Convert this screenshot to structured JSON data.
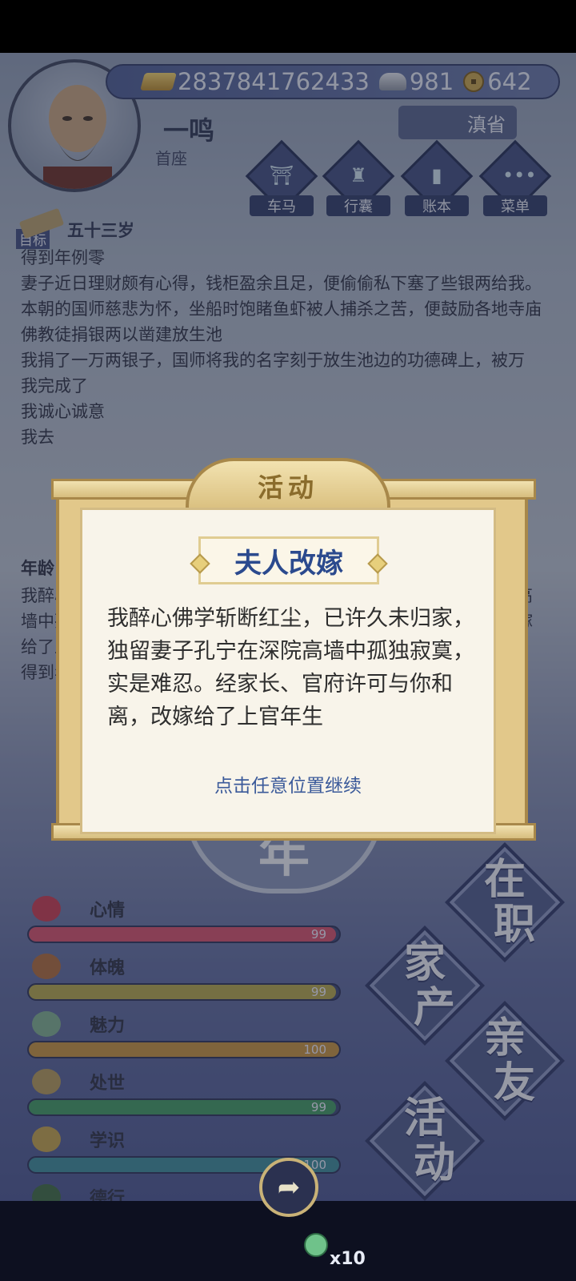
{
  "header": {
    "gold": "2837841762433",
    "silver": "981",
    "copper": "642",
    "name": "一鸣",
    "rank": "首座",
    "region": "滇省"
  },
  "menu": [
    {
      "label": "车马",
      "icon": "carriage-icon"
    },
    {
      "label": "行囊",
      "icon": "bag-icon"
    },
    {
      "label": "账本",
      "icon": "ledger-icon"
    },
    {
      "label": "菜单",
      "icon": "menu-dots-icon"
    }
  ],
  "target_label": "目标",
  "age_line": "五十三岁",
  "log": [
    "得到年例零",
    "妻子近日理财颇有心得，钱柜盈余且足，便偷偷私下塞了些银两给我。",
    "本朝的国师慈悲为怀，坐船时饱睹鱼虾被人捕杀之苦，便鼓励各地寺庙佛教徒捐银两以凿建放生池",
    "我捐了一万两银子，国师将我的名字刻于放生池边的功德碑上，被万",
    "我完成了",
    "我诚心诚意",
    "我去"
  ],
  "log2": {
    "head": "年龄 五",
    "left": [
      "我醉心",
      "墙中孤",
      "给了上",
      "得到年"
    ],
    "right": [
      "院高",
      "改嫁"
    ]
  },
  "year_char": "年",
  "stats": [
    {
      "name": "心情",
      "value": "99",
      "fill": 0.99,
      "color": "#d84f6a",
      "icon": "flower-icon"
    },
    {
      "name": "体魄",
      "value": "99",
      "fill": 0.99,
      "color": "#b5a64a",
      "icon": "body-icon"
    },
    {
      "name": "魅力",
      "value": "100",
      "fill": 1.0,
      "color": "#c7923c",
      "icon": "mirror-icon"
    },
    {
      "name": "处世",
      "value": "99",
      "fill": 0.99,
      "color": "#3f9a62",
      "icon": "hat-icon"
    },
    {
      "name": "学识",
      "value": "100",
      "fill": 1.0,
      "color": "#3b8a9a",
      "icon": "books-icon"
    },
    {
      "name": "德行",
      "value": "",
      "fill": 1.0,
      "color": "#5a3b6e",
      "icon": "virtue-icon"
    }
  ],
  "actions": [
    {
      "label": "在职",
      "lines": [
        "在",
        "职"
      ]
    },
    {
      "label": "家产",
      "lines": [
        "家",
        "产"
      ]
    },
    {
      "label": "亲友",
      "lines": [
        "亲",
        "友"
      ]
    },
    {
      "label": "活动",
      "lines": [
        "活",
        "动"
      ]
    }
  ],
  "share": {
    "count": "x10"
  },
  "modal": {
    "tab": "活动",
    "title": "夫人改嫁",
    "body": "我醉心佛学斩断红尘，已许久未归家，独留妻子孔宁在深院高墙中孤独寂寞，实是难忍。经家长、官府许可与你和离，改嫁给了上官年生",
    "hint": "点击任意位置继续"
  },
  "colors": {
    "accent": "#2b4a8e",
    "frame": "#a8884a",
    "panel": "#f8f4ea"
  }
}
